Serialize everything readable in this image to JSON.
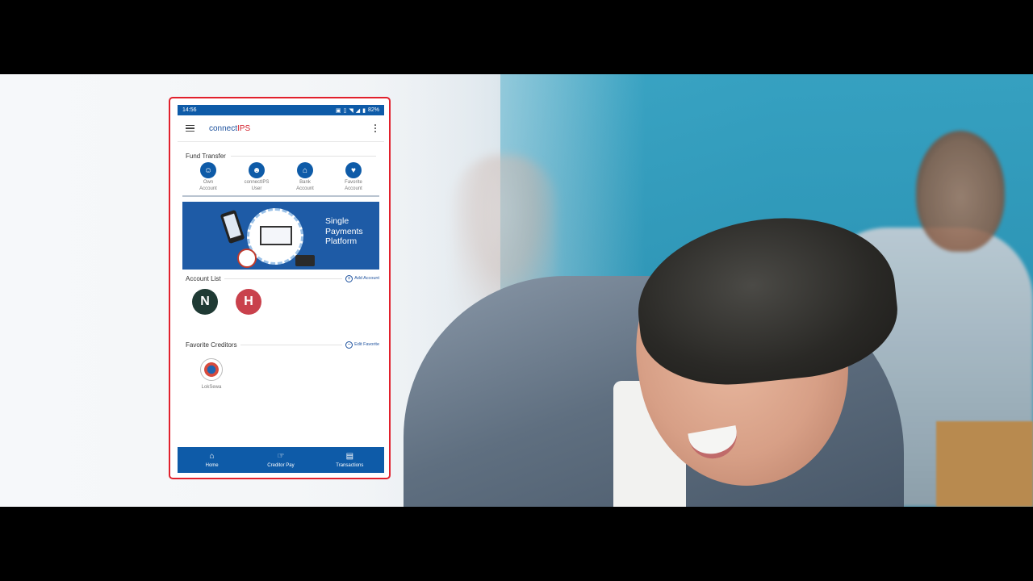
{
  "status_bar": {
    "time": "14:56",
    "battery": "82%"
  },
  "app": {
    "title_prefix": "connect",
    "title_suffix": "IPS"
  },
  "fund_transfer": {
    "title": "Fund Transfer",
    "items": [
      {
        "line1": "Own",
        "line2": "Account",
        "icon": "user-circle-icon"
      },
      {
        "line1": "connectIPS",
        "line2": "User",
        "icon": "users-icon"
      },
      {
        "line1": "Bank",
        "line2": "Account",
        "icon": "bank-icon"
      },
      {
        "line1": "Favorite",
        "line2": "Account",
        "icon": "favorite-user-icon"
      }
    ]
  },
  "banner": {
    "line1": "Single",
    "line2": "Payments",
    "line3": "Platform"
  },
  "account_list": {
    "title": "Account List",
    "add_label": "Add Account",
    "accounts": [
      {
        "initial": "N",
        "color": "#1f3a34"
      },
      {
        "initial": "H",
        "color": "#c9414c"
      }
    ]
  },
  "favorite_creditors": {
    "title": "Favorite Creditors",
    "edit_label": "Edit Favorite",
    "items": [
      {
        "label": "LokSewa"
      }
    ]
  },
  "bottom_nav": [
    {
      "label": "Home",
      "icon": "home-icon"
    },
    {
      "label": "Creditor Pay",
      "icon": "hand-pay-icon"
    },
    {
      "label": "Transactions",
      "icon": "printer-icon"
    }
  ],
  "colors": {
    "primary": "#0e5ba8",
    "accent_red": "#d3212c",
    "highlight_frame": "#e1202c"
  }
}
